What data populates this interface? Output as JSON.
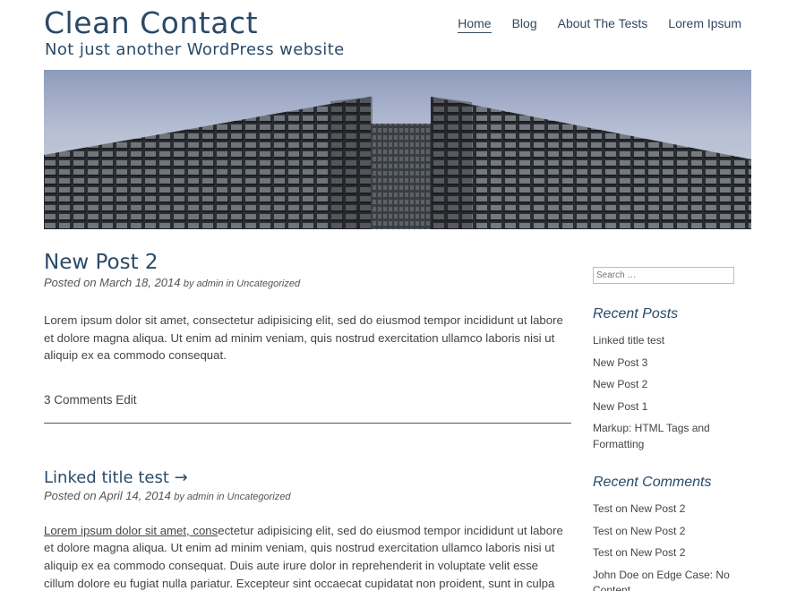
{
  "site": {
    "title": "Clean Contact",
    "description": "Not just another WordPress website"
  },
  "nav": {
    "items": [
      {
        "label": "Home",
        "active": true
      },
      {
        "label": "Blog"
      },
      {
        "label": "About The Tests"
      },
      {
        "label": "Lorem Ipsum"
      }
    ]
  },
  "posts": [
    {
      "title": "New Post 2",
      "posted_on": "Posted on March 18, 2014",
      "by": "by admin in Uncategorized",
      "excerpt": "Lorem ipsum dolor sit amet, consectetur adipisicing elit, sed do eiusmod tempor incididunt ut labore et dolore magna aliqua. Ut enim ad minim veniam, quis nostrud exercitation ullamco laboris nisi ut aliquip ex ea commodo consequat.",
      "comments_label": "3 Comments",
      "edit_label": "Edit"
    },
    {
      "title": "Linked title test →",
      "posted_on": "Posted on April 14, 2014",
      "by": "by admin in Uncategorized",
      "excerpt_link": "Lorem ipsum dolor sit amet, cons",
      "excerpt": "ectetur adipisicing elit, sed do eiusmod tempor incididunt ut labore et dolore magna aliqua. Ut enim ad minim veniam, quis nostrud exercitation ullamco laboris nisi ut aliquip ex ea commodo consequat. Duis aute irure dolor in reprehenderit in voluptate velit esse cillum dolore eu fugiat nulla pariatur. Excepteur sint occaecat cupidatat non proident, sunt in culpa qui officia"
    }
  ],
  "sidebar": {
    "search_placeholder": "Search …",
    "recent_posts_title": "Recent Posts",
    "recent_posts": [
      "Linked title test",
      "New Post 3",
      "New Post 2",
      "New Post 1",
      "Markup: HTML Tags and Formatting"
    ],
    "recent_comments_title": "Recent Comments",
    "recent_comments": [
      "Test on New Post 2",
      "Test on New Post 2",
      "Test on New Post 2",
      "John Doe on Edge Case: No Content"
    ]
  },
  "colors": {
    "heading": "#2a4a6a",
    "text": "#444444"
  }
}
